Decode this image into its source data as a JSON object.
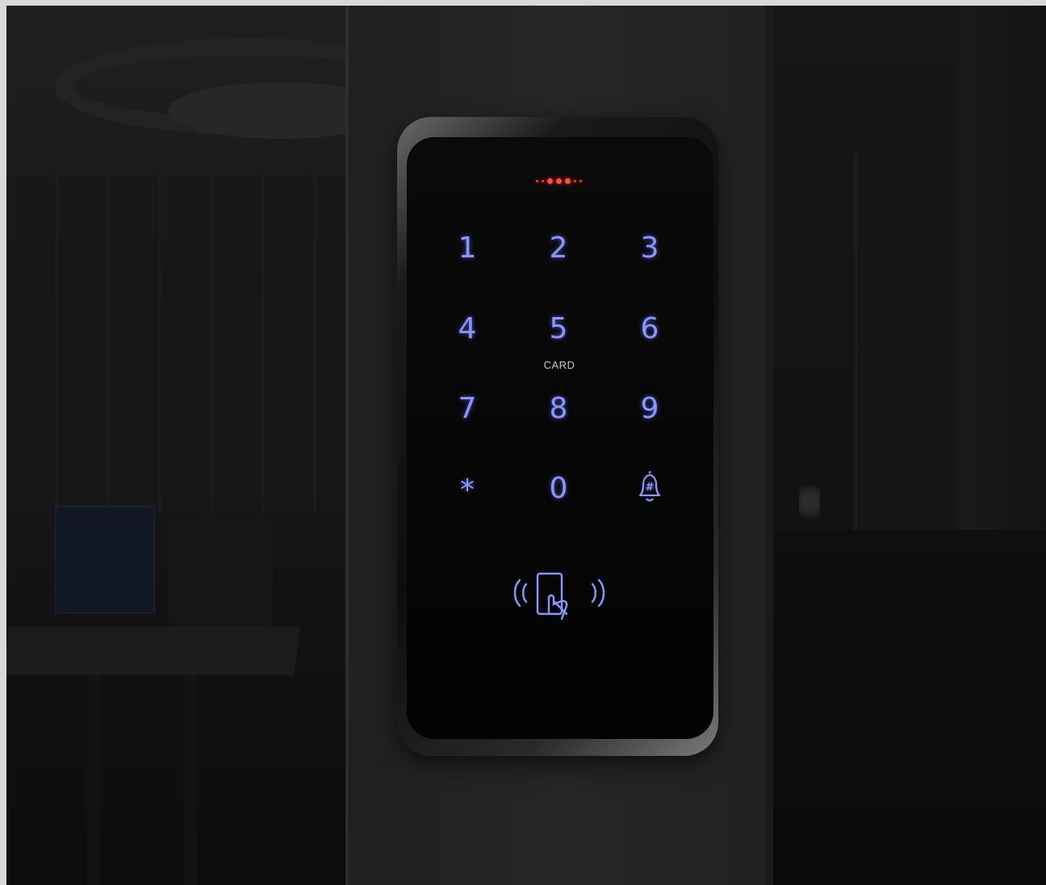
{
  "keypad": {
    "keys": [
      "1",
      "2",
      "3",
      "4",
      "5",
      "6",
      "7",
      "8",
      "9",
      "*",
      "0"
    ],
    "card_label": "CARD",
    "bell_key_symbol": "#",
    "bell_icon": "bell-icon",
    "rfid_icon": "rfid-card-tap-icon",
    "indicator_icon": "status-led-indicator"
  },
  "colors": {
    "key_glow": "#8a96ff",
    "indicator_led": "#ff3b3b",
    "device_face": "#050505"
  }
}
